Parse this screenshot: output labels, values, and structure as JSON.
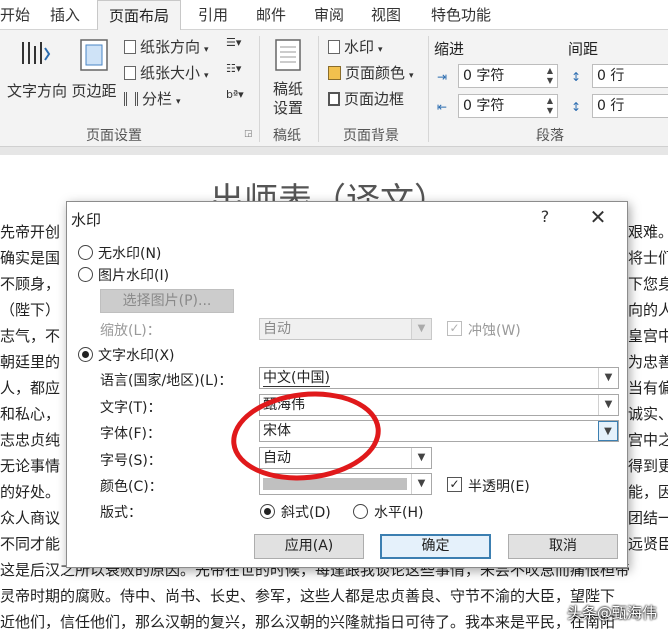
{
  "tabs": [
    "开始",
    "插入",
    "页面布局",
    "引用",
    "邮件",
    "审阅",
    "视图",
    "特色功能"
  ],
  "ribbon": {
    "page_setup": {
      "text_direction": "文字方向",
      "margins": "页边距",
      "orientation": "纸张方向",
      "size": "纸张大小",
      "columns": "分栏",
      "label": "页面设置"
    },
    "paper": {
      "cmd": "稿纸\n设置",
      "label": "稿纸"
    },
    "background": {
      "watermark": "水印",
      "page_color": "页面颜色",
      "page_border": "页面边框",
      "label": "页面背景"
    },
    "paragraph": {
      "indent_label": "缩进",
      "spacing_label": "间距",
      "indent_left": "0 字符",
      "indent_right": "0 字符",
      "space_before": "0 行",
      "space_after": "0 行",
      "label": "段落"
    }
  },
  "document": {
    "title": "出师表（译文）",
    "lines": [
      {
        "l": "先帝开创",
        "r": "艰难。"
      },
      {
        "l": "确实是国",
        "r": "将士们"
      },
      {
        "l": "不顾身，",
        "r": "下您身"
      },
      {
        "l": "（陛下）",
        "r": "向的人"
      },
      {
        "l": "志气，不",
        "r": "皇宫中"
      },
      {
        "l": "朝廷里的",
        "r": "为忠善"
      },
      {
        "l": "人，都应",
        "r": "当有偏"
      },
      {
        "l": "和私心，",
        "r": "诚实、"
      },
      {
        "l": "志忠贞纯",
        "r": "宫中之"
      },
      {
        "l": "无论事情",
        "r": "得到更"
      },
      {
        "l": "的好处。",
        "r": "能，因"
      },
      {
        "l": "众人商议",
        "r": "团结一"
      },
      {
        "l": "不同才能",
        "r": "远贤臣"
      },
      {
        "l": "这是后汉之所以衰败的原因。先帝在世的时候，每逢跟我谈论这些事情，未尝不叹息而痛恨桓帝",
        "r": ""
      },
      {
        "l": "灵帝时期的腐败。侍中、尚书、长史、参军，这些人都是忠贞善良、守节不渝的大臣，望陛下",
        "r": ""
      },
      {
        "l": "近他们，信任他们，那么汉朝的复兴，那么汉朝的兴隆就指日可待了。我本来是平民，在南阳",
        "r": ""
      }
    ]
  },
  "dialog": {
    "title": "水印",
    "help": "?",
    "close": "✕",
    "no_watermark": "无水印(N)",
    "picture_watermark": "图片水印(I)",
    "select_picture": "选择图片(P)...",
    "scale_label": "缩放(L)：",
    "scale_value": "自动",
    "washout_label": "冲蚀(W)",
    "text_watermark": "文字水印(X)",
    "language_label": "语言(国家/地区)(L)：",
    "language_value": "中文(中国)",
    "text_label": "文字(T)：",
    "text_value": "甄海伟",
    "font_label": "字体(F)：",
    "font_value": "宋体",
    "size_label": "字号(S)：",
    "size_value": "自动",
    "color_label": "颜色(C)：",
    "semi_transparent": "半透明(E)",
    "layout_label": "版式：",
    "diagonal": "斜式(D)",
    "horizontal": "水平(H)",
    "apply": "应用(A)",
    "ok": "确定",
    "cancel": "取消",
    "selected_mode": "text",
    "selected_layout": "diagonal",
    "semi_transparent_checked": true
  },
  "source_watermark": "头条@甄海伟",
  "colors": {
    "annotation_ellipse": "#e0191b",
    "primary_button_border": "#3c7fb1"
  }
}
